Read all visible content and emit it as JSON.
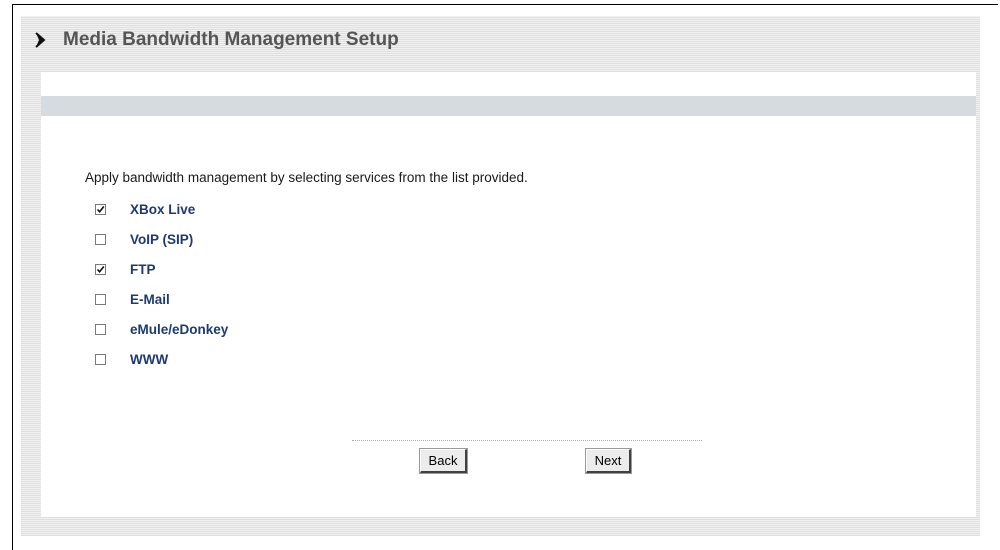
{
  "page": {
    "title": "Media Bandwidth Management Setup",
    "instruction": "Apply bandwidth management by selecting services from the list provided."
  },
  "services": [
    {
      "label": "XBox Live",
      "checked": true
    },
    {
      "label": "VoIP (SIP)",
      "checked": false
    },
    {
      "label": "FTP",
      "checked": true
    },
    {
      "label": "E-Mail",
      "checked": false
    },
    {
      "label": "eMule/eDonkey",
      "checked": false
    },
    {
      "label": "WWW",
      "checked": false
    }
  ],
  "buttons": {
    "back": "Back",
    "next": "Next"
  },
  "icons": {
    "header": "chevron-right-icon",
    "check": "checkmark-icon"
  },
  "colors": {
    "title": "#555555",
    "service_label": "#1e3a6e",
    "band": "#d5dbdf"
  }
}
